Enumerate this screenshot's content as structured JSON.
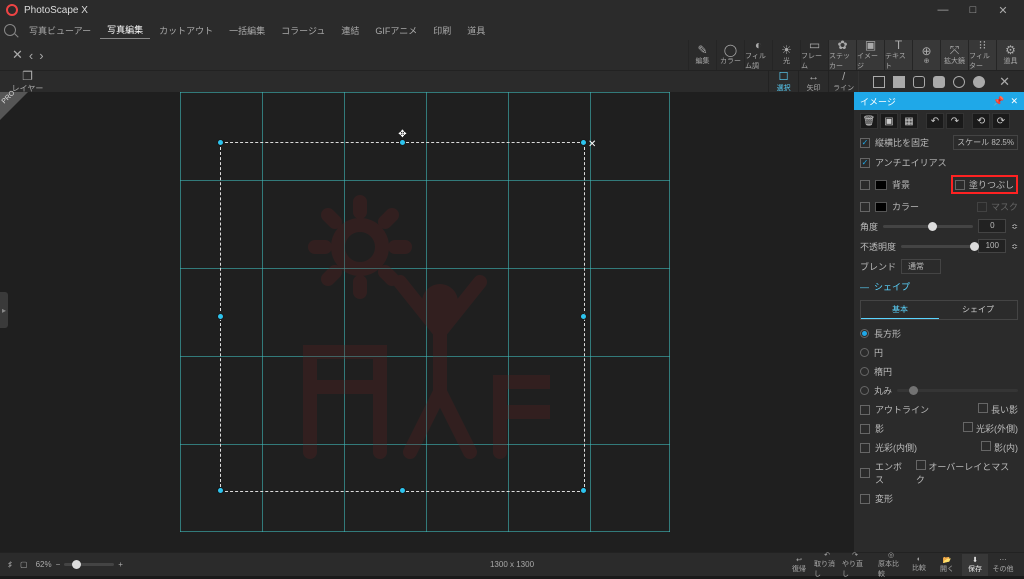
{
  "app": {
    "title": "PhotoScape X"
  },
  "window": {
    "min": "—",
    "max": "□",
    "close": "✕"
  },
  "menu": [
    "写真ビューアー",
    "写真編集",
    "カットアウト",
    "一括編集",
    "コラージュ",
    "連結",
    "GIFアニメ",
    "印刷",
    "道具"
  ],
  "menu_active": 1,
  "closebar": {
    "x": "✕",
    "back": "‹",
    "fwd": "›"
  },
  "tools_right": [
    {
      "ic": "✎",
      "lbl": "編集"
    },
    {
      "ic": "◯",
      "lbl": "カラー"
    },
    {
      "ic": "◐",
      "lbl": "フィルム調"
    },
    {
      "ic": "☀",
      "lbl": "光"
    },
    {
      "ic": "▭",
      "lbl": "フレーム"
    },
    {
      "ic": "✿",
      "lbl": "ステッカー"
    },
    {
      "ic": "▣",
      "lbl": "イメージ"
    },
    {
      "ic": "T",
      "lbl": "テキスト"
    },
    {
      "ic": "⊕",
      "lbl": "⊕"
    },
    {
      "ic": "⤧",
      "lbl": "拡大鏡"
    },
    {
      "ic": "⁝⁝",
      "lbl": "フィルター"
    },
    {
      "ic": "⚙",
      "lbl": "道具"
    }
  ],
  "subtools": [
    {
      "ic": "☐",
      "lbl": "選択",
      "active": true
    },
    {
      "ic": "↔",
      "lbl": "矢印",
      "active": false
    },
    {
      "ic": "/",
      "lbl": "ライン",
      "active": false
    }
  ],
  "layers": "レイヤー",
  "pro": "PRO",
  "rpanel": {
    "title": "イメージ",
    "pin": "📌",
    "close": "✕",
    "icons": [
      "🗑",
      "▣",
      "▦",
      "|",
      "↶",
      "↷",
      "|",
      "⟲",
      "⟳"
    ],
    "aspect": "縦横比を固定",
    "scale": "スケール 82.5%",
    "antialias": "アンチエイリアス",
    "bg": "背景",
    "fill": "塗りつぶし",
    "color": "カラー",
    "mask": "マスク",
    "angle": "角度",
    "angle_val": "0",
    "opacity": "不透明度",
    "opacity_val": "100",
    "blend": "ブレンド",
    "blend_val": "通常",
    "shape_section": "シェイプ",
    "tab_basic": "基本",
    "tab_shape": "シェイプ",
    "shape_rect": "長方形",
    "shape_circle": "円",
    "shape_ellipse": "楕円",
    "shape_round": "丸み",
    "outline": "アウトライン",
    "longshadow": "長い影",
    "shadow": "影",
    "glow_out": "光彩(外側)",
    "glow_in": "光彩(内側)",
    "bevel": "影(内)",
    "emboss": "エンボス",
    "overlay": "オーバーレイとマスク",
    "transform": "変形"
  },
  "bottom": {
    "zoom": "62%",
    "dims": "1300 x 1300",
    "undo": "復帰",
    "undo2": "取り消し",
    "redo": "やり直し",
    "orig": "原本比較",
    "compare": "比較",
    "open": "開く",
    "save": "保存",
    "share": "その他"
  }
}
